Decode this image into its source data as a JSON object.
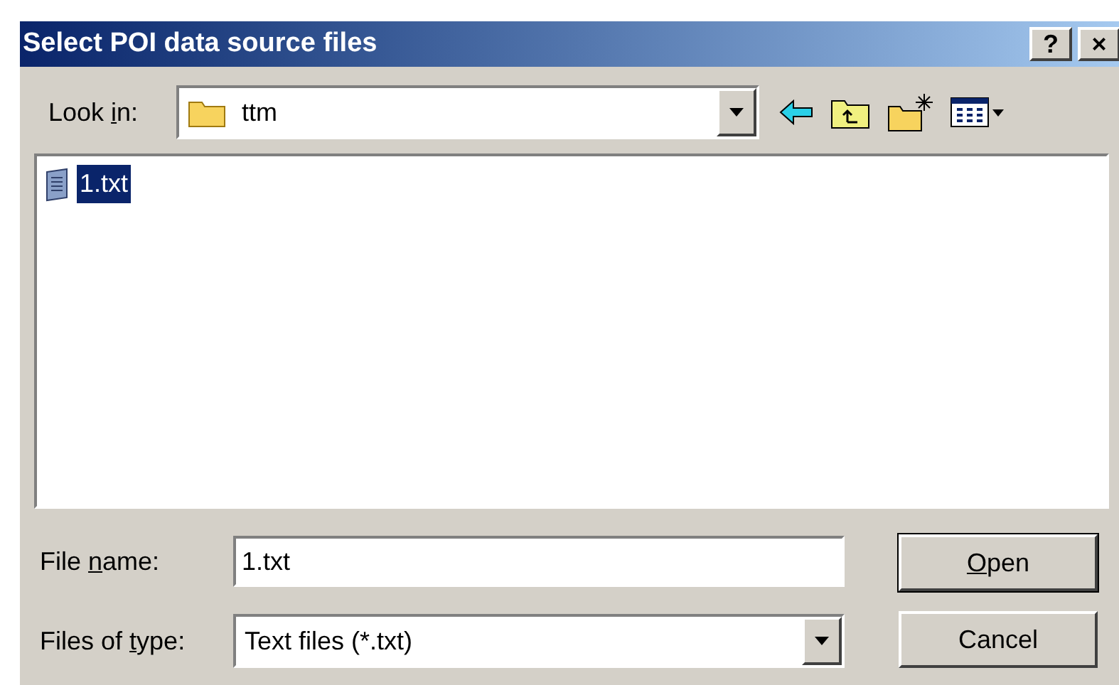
{
  "window": {
    "title": "Select POI data source files",
    "title_buttons": [
      "?",
      "×"
    ]
  },
  "look_in": {
    "label": [
      {
        "text": "Look ",
        "underline": false
      },
      {
        "text": "i",
        "underline": true
      },
      {
        "text": "n:",
        "underline": false
      }
    ],
    "value": "ttm"
  },
  "files": [
    {
      "name": "1.txt",
      "selected": true
    }
  ],
  "file_name": {
    "label": [
      {
        "text": "File ",
        "underline": false
      },
      {
        "text": "n",
        "underline": true
      },
      {
        "text": "ame:",
        "underline": false
      }
    ],
    "value": "1.txt"
  },
  "file_type": {
    "label": [
      {
        "text": "Files of ",
        "underline": false
      },
      {
        "text": "t",
        "underline": true
      },
      {
        "text": "ype:",
        "underline": false
      }
    ],
    "value": "Text files (*.txt)"
  },
  "buttons": [
    {
      "label": [
        {
          "text": "O",
          "underline": true
        },
        {
          "text": "pen",
          "underline": false
        }
      ],
      "default": true
    },
    {
      "label": [
        {
          "text": "Cancel",
          "underline": false
        }
      ],
      "default": false
    }
  ]
}
